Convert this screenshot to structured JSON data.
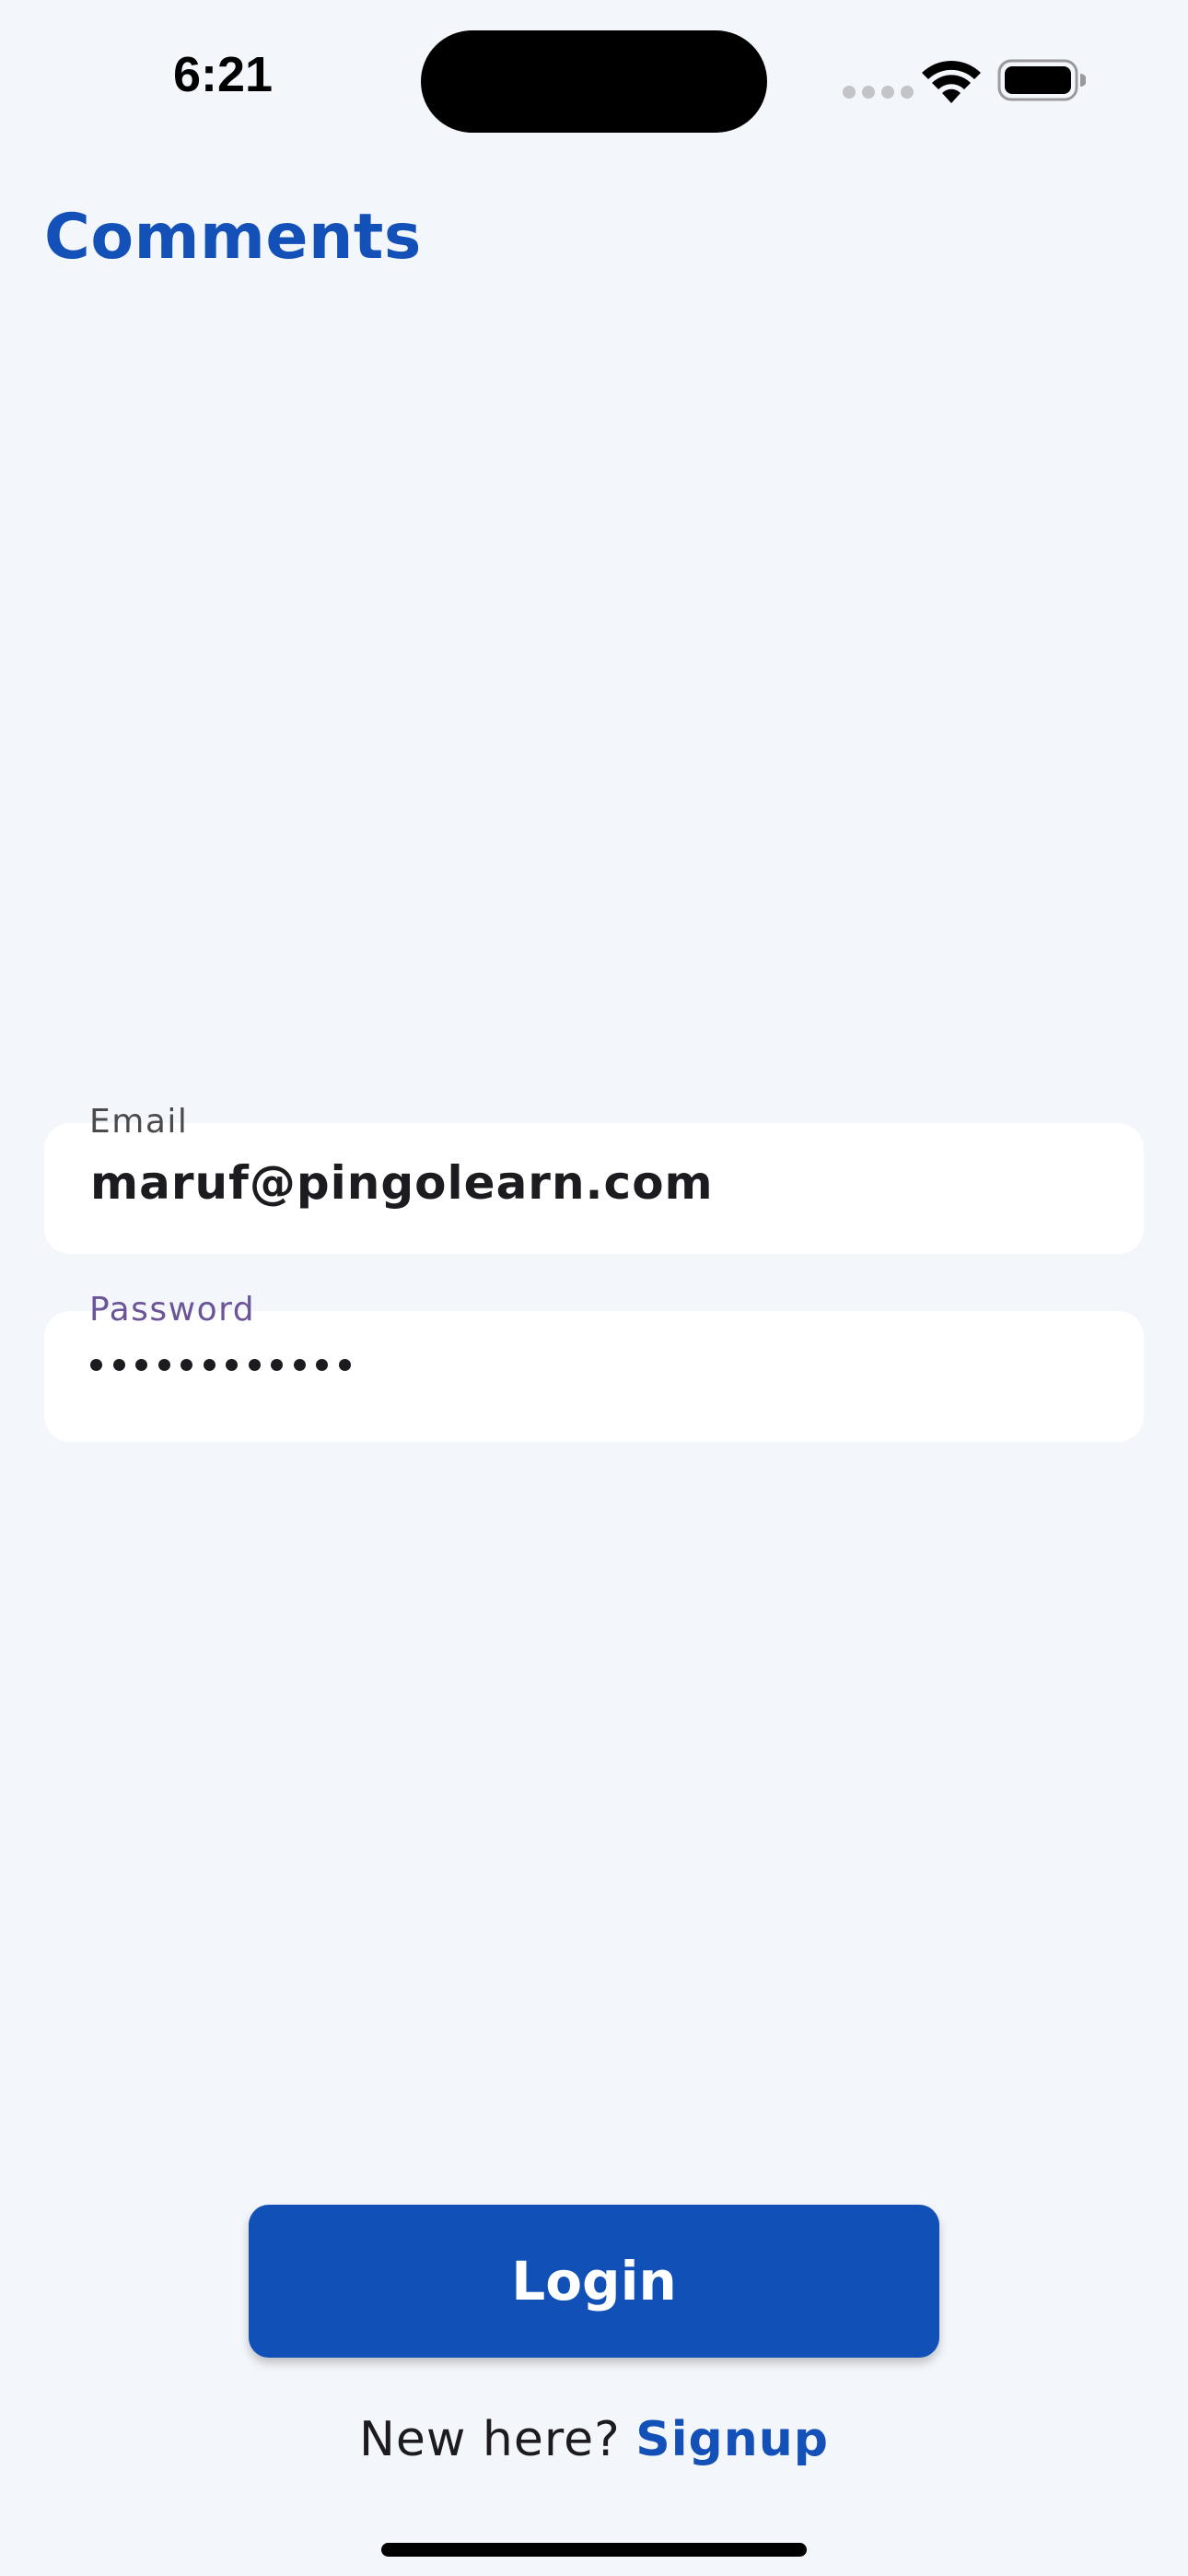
{
  "status_bar": {
    "time": "6:21"
  },
  "header": {
    "title": "Comments"
  },
  "form": {
    "email": {
      "label": "Email",
      "value": "maruf@pingolearn.com"
    },
    "password": {
      "label": "Password",
      "masked_length": 12
    }
  },
  "actions": {
    "login_label": "Login",
    "signup_prompt": "New here?",
    "signup_label": "Signup"
  },
  "colors": {
    "accent": "#1351b8",
    "background": "#f3f6fb",
    "password_label": "#6b5497"
  },
  "icons": [
    "wifi-icon",
    "battery-icon",
    "signal-icon"
  ]
}
